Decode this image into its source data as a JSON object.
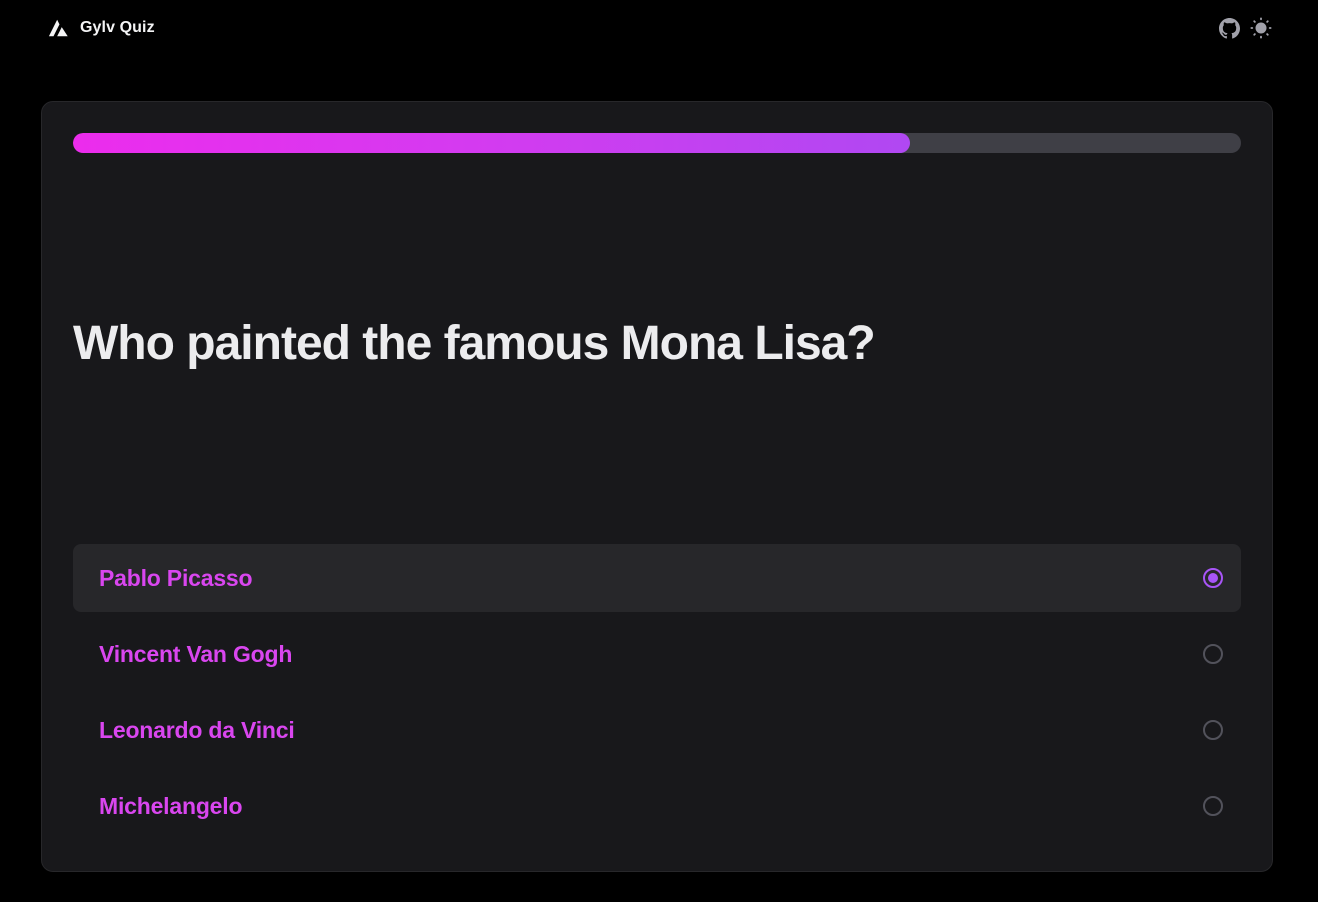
{
  "app": {
    "title": "Gylv Quiz",
    "logo_icon": "triangle-logo-icon",
    "actions": [
      {
        "name": "github",
        "icon": "github-icon"
      },
      {
        "name": "theme-toggle",
        "icon": "sun-icon"
      }
    ]
  },
  "quiz": {
    "progress_fraction": 0.717,
    "question": "Who painted the famous Mona Lisa?",
    "options": [
      {
        "label": "Pablo Picasso",
        "selected": true
      },
      {
        "label": "Vincent Van Gogh",
        "selected": false
      },
      {
        "label": "Leonardo da Vinci",
        "selected": false
      },
      {
        "label": "Michelangelo",
        "selected": false
      }
    ]
  },
  "colors": {
    "background": "#000000",
    "card": "#18181b",
    "accent": "#d946ef",
    "accent_secondary": "#a855f7",
    "progress_start": "#ec2ced",
    "progress_end": "#b048f2",
    "text_primary": "#ececee"
  }
}
